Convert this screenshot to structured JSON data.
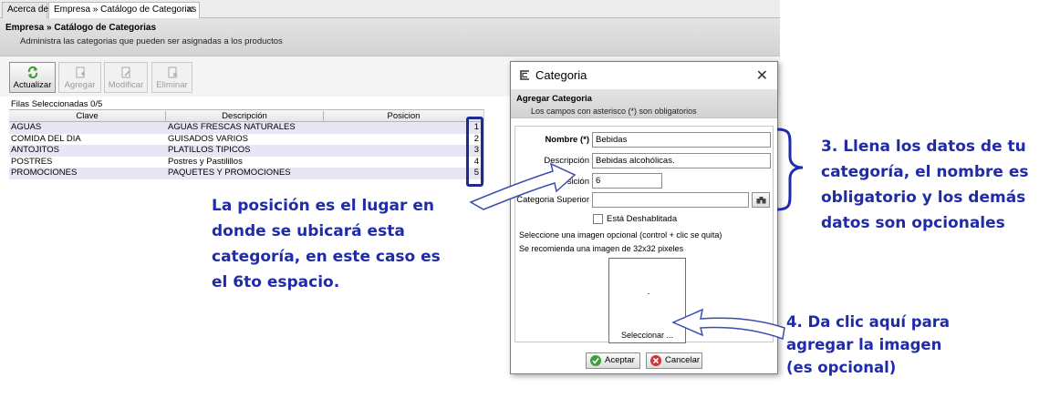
{
  "tabs": [
    {
      "label": "Acerca de",
      "active": false
    },
    {
      "label": "Empresa » Catálogo de Categorias",
      "active": true,
      "close": "✕"
    }
  ],
  "header": {
    "title": "Empresa » Catálogo de Categorias",
    "subtitle": "Administra las categorias que pueden ser asignadas a los productos"
  },
  "toolbar": {
    "refresh": "Actualizar",
    "add": "Agregar",
    "modify": "Modificar",
    "delete": "Eliminar"
  },
  "selection_count": "Filas Seleccionadas 0/5",
  "table": {
    "columns": [
      "Clave",
      "Descripción",
      "Posicion"
    ],
    "rows": [
      {
        "clave": "AGUAS",
        "descripcion": "AGUAS FRESCAS NATURALES",
        "posicion": "1"
      },
      {
        "clave": "COMIDA DEL DIA",
        "descripcion": "GUISADOS VARIOS",
        "posicion": "2"
      },
      {
        "clave": "ANTOJITOS",
        "descripcion": "PLATILLOS TIPICOS",
        "posicion": "3"
      },
      {
        "clave": "POSTRES",
        "descripcion": "Postres y Pastilillos",
        "posicion": "4"
      },
      {
        "clave": "PROMOCIONES",
        "descripcion": "PAQUETES Y PROMOCIONES",
        "posicion": "5"
      }
    ]
  },
  "dialog": {
    "title": "Categoria",
    "close": "✕",
    "head_title": "Agregar Categoria",
    "head_subtitle": "Los campos con asterisco (*) son obligatorios",
    "fields": {
      "nombre_label": "Nombre (*)",
      "nombre_value": "Bebidas",
      "descripcion_label": "Descripción",
      "descripcion_value": "Bebidas alcohólicas.",
      "posicion_label": "Posición",
      "posicion_value": "6",
      "superior_label": "Categoria Superior",
      "superior_value": ""
    },
    "disabled_label": "Está Deshablitada",
    "image_hint1": "Seleccione una imagen opcional (control + clic se quita)",
    "image_hint2": "Se recomienda una imagen de 32x32 pixeles",
    "select_image": "Seleccionar ...",
    "accept": "Aceptar",
    "cancel": "Cancelar"
  },
  "annotations": {
    "left": [
      "La posición es el lugar en",
      "donde se ubicará esta",
      "categoría, en este caso es",
      "el 6to espacio."
    ],
    "right": [
      "3. Llena los datos de tu",
      "categoría, el nombre es",
      "obligatorio y los demás",
      "datos son opcionales"
    ],
    "bottom": [
      "4. Da clic aquí para",
      "agregar la imagen",
      "(es opcional)"
    ]
  },
  "colors": {
    "annotation": "#1f2ba8",
    "row_alt": "#e6e6f5"
  }
}
